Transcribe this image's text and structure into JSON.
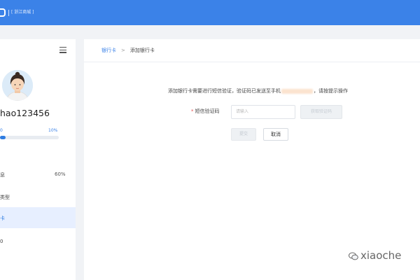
{
  "header": {
    "subtitle": "[ 浙江商城 ]"
  },
  "sidebar": {
    "username": "hao123456",
    "progress": {
      "label": "0",
      "percent_label": "10%",
      "value": 0.1
    },
    "rows": [
      {
        "label": "息",
        "value": "60%"
      },
      {
        "label": "类型",
        "value": ""
      },
      {
        "label": "卡",
        "value": ""
      },
      {
        "label": "0",
        "value": ""
      }
    ]
  },
  "breadcrumb": {
    "link": "银行卡",
    "separator": ">",
    "current": "添加银行卡"
  },
  "notice": {
    "text_before": "添加银行卡需要进行短信验证，验证码已发送至手机",
    "text_after": "，请按提示操作"
  },
  "form": {
    "field_label": "短信验证码",
    "required_mark": "*",
    "input_placeholder": "请输入",
    "send_button": "获取验证码",
    "submit_button": "提交",
    "cancel_button": "取消"
  },
  "watermark": {
    "text": "xiaoche"
  },
  "colors": {
    "primary": "#3b82e8",
    "required": "#e64b4b"
  }
}
